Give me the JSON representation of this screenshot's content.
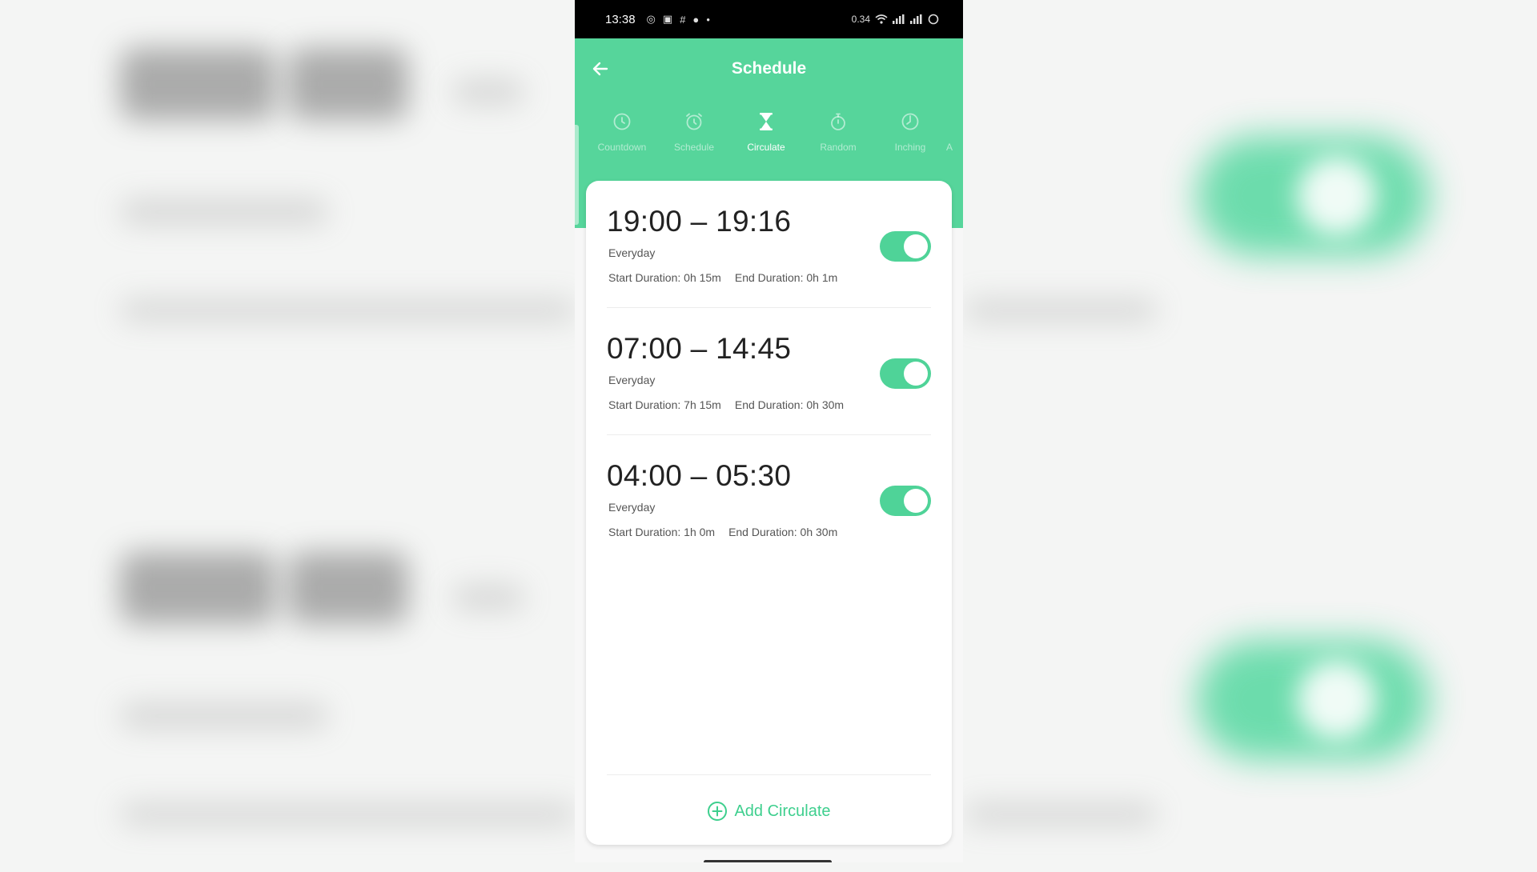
{
  "status_bar": {
    "time": "13:38",
    "left_icons": [
      "whatsapp-icon",
      "photo-icon",
      "grid-icon",
      "chat-icon",
      "dot-icon"
    ],
    "right_text": "0.34"
  },
  "header": {
    "title": "Schedule",
    "background_color": "#56d59b"
  },
  "tabs": [
    {
      "label": "Countdown",
      "icon": "clock-icon",
      "active": false
    },
    {
      "label": "Schedule",
      "icon": "alarm-clock-icon",
      "active": false
    },
    {
      "label": "Circulate",
      "icon": "hourglass-icon",
      "active": true
    },
    {
      "label": "Random",
      "icon": "stopwatch-icon",
      "active": false
    },
    {
      "label": "Inching",
      "icon": "timer-icon",
      "active": false
    }
  ],
  "tab_overflow_label": "A",
  "schedules": [
    {
      "time_range": "19:00 – 19:16",
      "repeat": "Everyday",
      "start_duration": "Start Duration: 0h 15m",
      "end_duration": "End Duration: 0h 1m",
      "enabled": true
    },
    {
      "time_range": "07:00 – 14:45",
      "repeat": "Everyday",
      "start_duration": "Start Duration: 7h 15m",
      "end_duration": "End Duration: 0h 30m",
      "enabled": true
    },
    {
      "time_range": "04:00 – 05:30",
      "repeat": "Everyday",
      "start_duration": "Start Duration: 1h 0m",
      "end_duration": "End Duration: 0h 30m",
      "enabled": true
    }
  ],
  "add_button": {
    "label": "Add Circulate",
    "icon": "plus-circle-icon"
  },
  "colors": {
    "accent": "#4fd398",
    "text_dark": "#222222",
    "text_muted": "#555555"
  }
}
